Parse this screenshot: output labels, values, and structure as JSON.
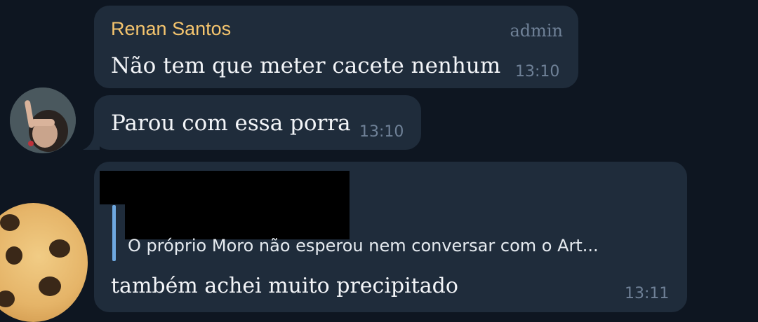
{
  "messages": [
    {
      "sender": "Renan Santos",
      "role": "admin",
      "text": "Não tem que meter cacete nenhum",
      "time": "13:10"
    },
    {
      "text": "Parou com essa porra",
      "time": "13:10"
    },
    {
      "reply_preview": "O próprio Moro não esperou nem conversar com o Art...",
      "text": "também achei muito precipitado",
      "time": "13:11"
    }
  ],
  "colors": {
    "background": "#0e1621",
    "bubble": "#1f2c3b",
    "sender_name": "#f5c56e",
    "meta_text": "#6f8197",
    "reply_bar": "#6ea8e0"
  },
  "icons": {
    "avatar_1": "person-photo-avatar",
    "avatar_2": "cookie-sticker-avatar"
  }
}
